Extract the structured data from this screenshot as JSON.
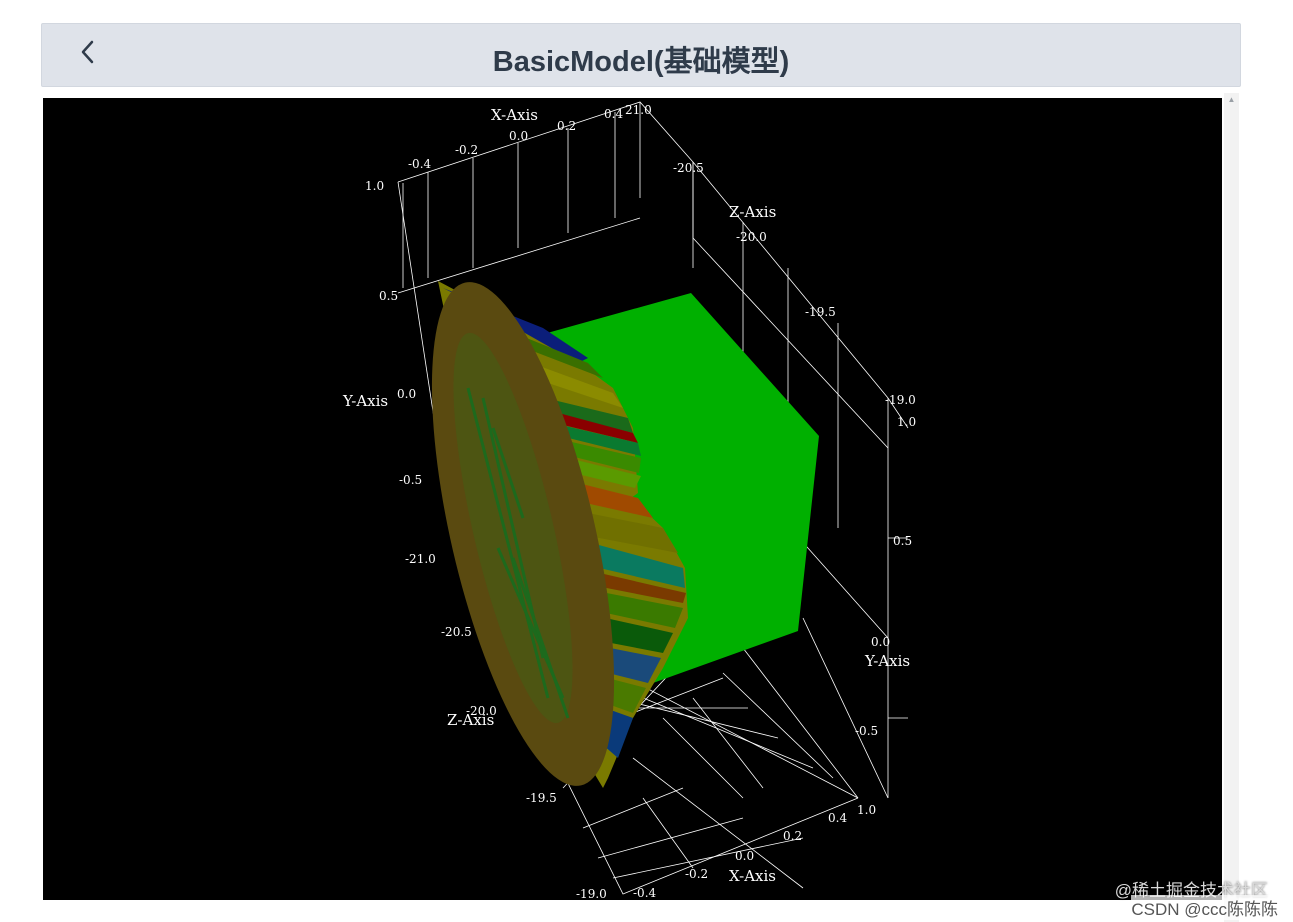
{
  "header": {
    "title": "BasicModel(基础模型)",
    "back_icon": "chevron-left-icon"
  },
  "plot": {
    "axis_titles": {
      "x_top": "X-Axis",
      "x_bottom": "X-Axis",
      "y_left": "Y-Axis",
      "y_right": "Y-Axis",
      "z_left": "Z-Axis",
      "z_right": "Z-Axis"
    },
    "x_ticks_top": [
      "-0.4",
      "-0.2",
      "0.0",
      "0.2",
      "0.4"
    ],
    "x_ticks_bottom": [
      "-0.4",
      "-0.2",
      "0.0",
      "0.2",
      "0.4"
    ],
    "y_ticks_left": [
      "1.0",
      "0.5",
      "0.0",
      "-0.5"
    ],
    "y_ticks_right": [
      "1.0",
      "0.5",
      "0.0",
      "-0.5",
      "1.0"
    ],
    "z_ticks_left": [
      "-21.0",
      "-20.5",
      "-20.0",
      "-19.5",
      "-19.0"
    ],
    "z_ticks_right": [
      "21.0",
      "-20.5",
      "-20.0",
      "-19.5",
      "-19.0"
    ],
    "colors": {
      "background": "#000000",
      "grid": "#ffffff",
      "plane": "#00b000",
      "disc": "#5a4a10"
    }
  },
  "watermark": {
    "line1": "@稀土掘金技术社区",
    "line2": "CSDN @ccc陈陈陈"
  }
}
